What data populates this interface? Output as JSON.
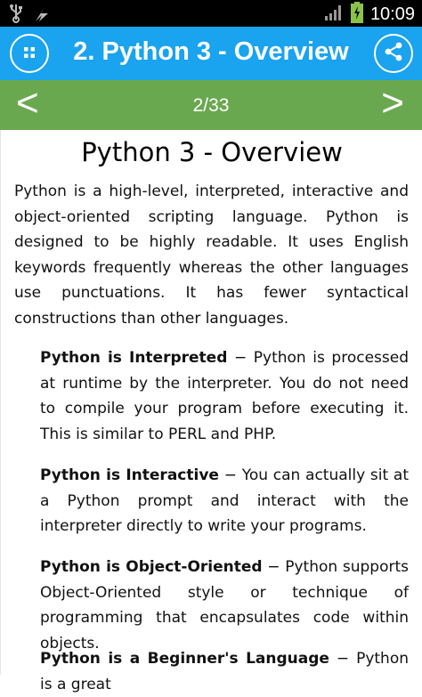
{
  "status": {
    "time": "10:09",
    "icons": [
      "usb-icon",
      "flash-icon",
      "signal-icon",
      "battery-charging-icon"
    ]
  },
  "appbar": {
    "title": "2. Python 3 - Overview",
    "menu_icon": "grid-menu-icon",
    "share_icon": "share-icon",
    "color": "#1aa3ee"
  },
  "nav": {
    "prev": "<",
    "next": ">",
    "page": "2/33",
    "color": "#6aa84f"
  },
  "content": {
    "heading": "Python 3 - Overview",
    "intro": "Python is a high-level, interpreted, interactive and object-oriented scripting language. Python is designed to be highly readable. It uses English keywords frequently whereas the other languages use punctuations. It has fewer syntactical constructions than other languages.",
    "items": [
      {
        "term": "Python is Interpreted",
        "desc": " − Python is processed at runtime by the interpreter. You do not need to compile your program before executing it. This is similar to PERL and PHP."
      },
      {
        "term": "Python is Interactive",
        "desc": " − You can actually sit at a Python prompt and interact with the interpreter directly to write your programs."
      },
      {
        "term": "Python is Object-Oriented",
        "desc": " − Python supports Object-Oriented style or technique of programming that encapsulates code within objects."
      },
      {
        "term": "Python is a Beginner's Language",
        "desc": " − Python is a great"
      }
    ]
  }
}
